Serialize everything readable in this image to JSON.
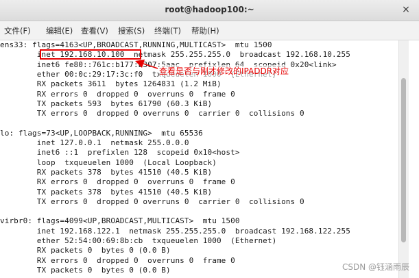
{
  "window": {
    "title": "root@hadoop100:~",
    "close_glyph": "×"
  },
  "menu": [
    "文件(F)",
    "编辑(E)",
    "查看(V)",
    "搜索(S)",
    "终端(T)",
    "帮助(H)"
  ],
  "terminal_lines": [
    "ens33: flags=4163<UP,BROADCAST,RUNNING,MULTICAST>  mtu 1500",
    "        inet 192.168.10.100  netmask 255.255.255.0  broadcast 192.168.10.255",
    "        inet6 fe80::761c:b177:b307:5aac  prefixlen 64  scopeid 0x20<link>",
    "        ether 00:0c:29:17:3c:f0  txqueuelen 1000  (Ethernet)",
    "        RX packets 3611  bytes 1264831 (1.2 MiB)",
    "        RX errors 0  dropped 0  overruns 0  frame 0",
    "        TX packets 593  bytes 61790 (60.3 KiB)",
    "        TX errors 0  dropped 0 overruns 0  carrier 0  collisions 0",
    "",
    "lo: flags=73<UP,LOOPBACK,RUNNING>  mtu 65536",
    "        inet 127.0.0.1  netmask 255.0.0.0",
    "        inet6 ::1  prefixlen 128  scopeid 0x10<host>",
    "        loop  txqueuelen 1000  (Local Loopback)",
    "        RX packets 378  bytes 41510 (40.5 KiB)",
    "        RX errors 0  dropped 0  overruns 0  frame 0",
    "        TX packets 378  bytes 41510 (40.5 KiB)",
    "        TX errors 0  dropped 0 overruns 0  carrier 0  collisions 0",
    "",
    "virbr0: flags=4099<UP,BROADCAST,MULTICAST>  mtu 1500",
    "        inet 192.168.122.1  netmask 255.255.255.0  broadcast 192.168.122.255",
    "        ether 52:54:00:69:8b:cb  txqueuelen 1000  (Ethernet)",
    "        RX packets 0  bytes 0 (0.0 B)",
    "        RX errors 0  dropped 0  overruns 0  frame 0",
    "        TX packets 0  bytes 0 (0.0 B)"
  ],
  "annotation": {
    "text": "查看是否与刚才修改的IPADDR对应",
    "color": "#e60000"
  },
  "watermark": "CSDN @钰涵雨辰"
}
